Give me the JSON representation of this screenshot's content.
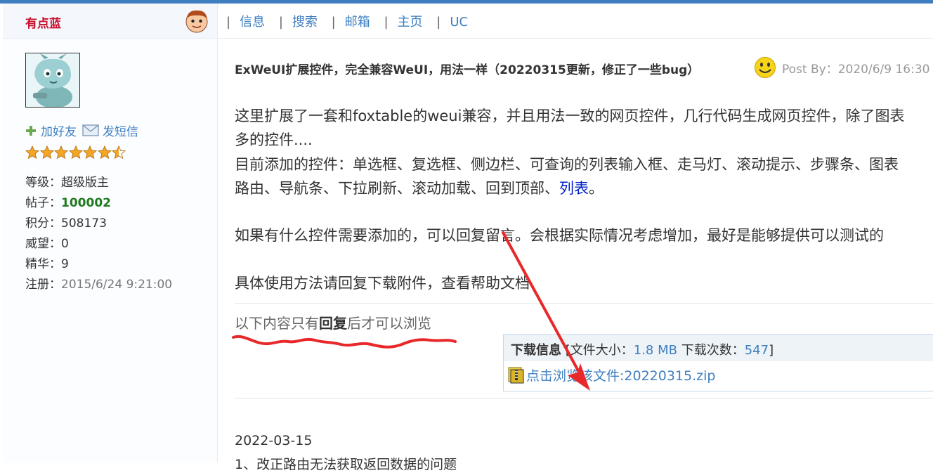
{
  "sidebar": {
    "username": "有点蓝",
    "add_friend": "加好友",
    "send_message": "发短信",
    "stars": 6.5,
    "info": [
      {
        "label": "等级：",
        "value": "超级版主"
      },
      {
        "label": "帖子：",
        "value": "100002"
      },
      {
        "label": "积分：",
        "value": "508173"
      },
      {
        "label": "威望：",
        "value": "0"
      },
      {
        "label": "精华：",
        "value": "9"
      },
      {
        "label": "注册：",
        "value": "2015/6/24 9:21:00"
      }
    ]
  },
  "nav": {
    "sep": "|",
    "items": [
      "信息",
      "搜索",
      "邮箱",
      "主页",
      "UC"
    ]
  },
  "post": {
    "title": "ExWeUI扩展控件，完全兼容WeUI，用法一样（20220315更新，修正了一些bug）",
    "post_by_label": "Post By：",
    "post_date": "2020/6/9 16:30",
    "lines": [
      "这里扩展了一套和foxtable的weui兼容，并且用法一致的网页控件，几行代码生成网页控件，除了图表",
      "多的控件....",
      "目前添加的控件：单选框、复选框、侧边栏、可查询的列表输入框、走马灯、滚动提示、步骤条、图表",
      "路由、导航条、下拉刷新、滚动加载、回到顶部、"
    ],
    "list_link": "列表",
    "period": "。",
    "line_request": "如果有什么控件需要添加的，可以回复留言。会根据实际情况考虑增加，最好是能够提供可以测试的",
    "line_usage": "具体使用方法请回复下载附件，查看帮助文档",
    "reply_note_pre": "以下内容只有",
    "reply_note_bold": "回复",
    "reply_note_post": "后才可以浏览",
    "download": {
      "label": "下载信息",
      "open": " [文件大小：",
      "size": "1.8 MB",
      "count_label": "  下载次数：",
      "count": "547",
      "close": "]",
      "file_link": "点击浏览该文件:20220315.zip"
    },
    "date": "2022-03-15",
    "note": "1、改正路由无法获取返回数据的问题"
  },
  "colors": {
    "accent": "#3f7fc0",
    "username": "#c8102e",
    "annotation": "#e8282a"
  }
}
